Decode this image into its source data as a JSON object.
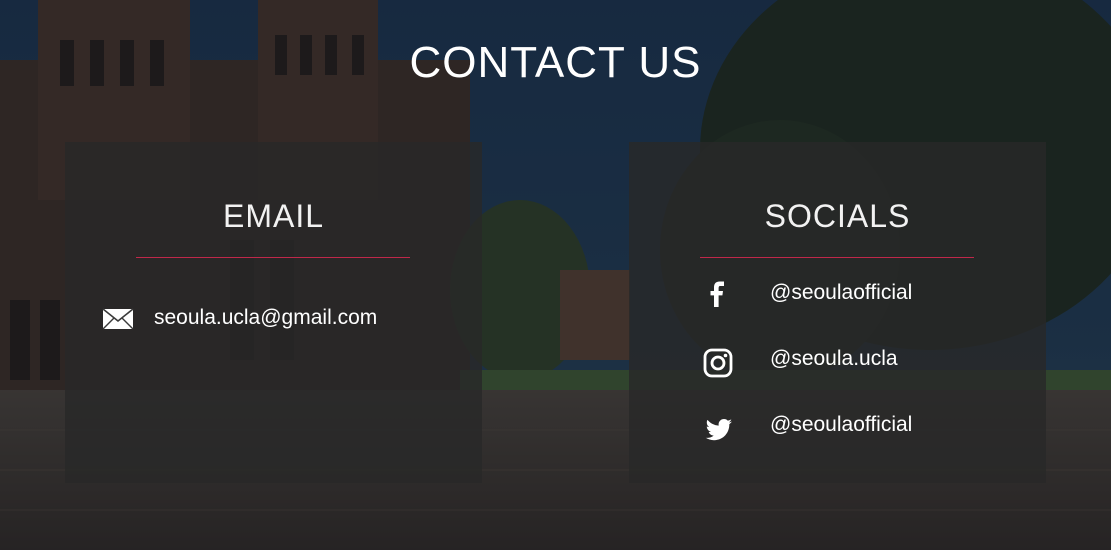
{
  "page": {
    "title": "CONTACT US"
  },
  "email_card": {
    "title": "EMAIL",
    "icon": "envelope-icon",
    "address": "seoula.ucla@gmail.com"
  },
  "socials_card": {
    "title": "SOCIALS",
    "items": [
      {
        "icon": "facebook-icon",
        "handle": "@seoulaofficial"
      },
      {
        "icon": "instagram-icon",
        "handle": "@seoula.ucla"
      },
      {
        "icon": "twitter-icon",
        "handle": "@seoulaofficial"
      }
    ]
  },
  "colors": {
    "card_background": "#282828",
    "divider": "#c0284a",
    "text": "#ffffff"
  }
}
